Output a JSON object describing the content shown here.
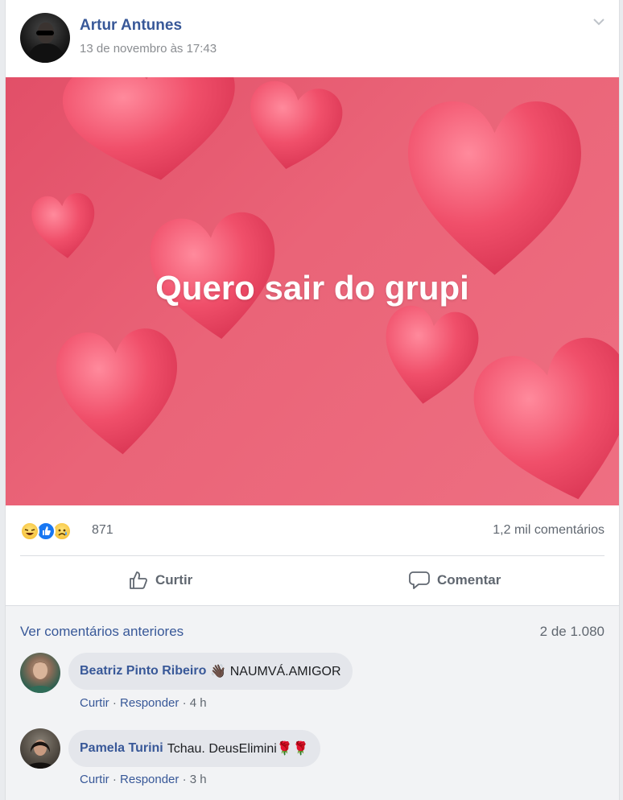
{
  "post": {
    "author": "Artur Antunes",
    "timestamp": "13 de novembro às 17:43",
    "text": "Quero sair do grupi",
    "background_color": "#e85a70",
    "reactions": {
      "icons": [
        "laugh-reaction-icon",
        "like-reaction-icon",
        "sad-reaction-icon"
      ],
      "count": "871"
    },
    "comments_count": "1,2 mil comentários",
    "actions": {
      "like": "Curtir",
      "comment": "Comentar"
    }
  },
  "comments_section": {
    "view_previous": "Ver comentários anteriores",
    "pager": "2 de 1.080",
    "items": [
      {
        "name": "Beatriz Pinto Ribeiro",
        "text": "👋🏿 NAUMVÁ.AMIGOR",
        "like": "Curtir",
        "reply": "Responder",
        "time": "4 h"
      },
      {
        "name": "Pamela Turini",
        "text": "Tchau. DeusElimini🌹🌹",
        "like": "Curtir",
        "reply": "Responder",
        "time": "3 h"
      }
    ]
  },
  "colors": {
    "link_blue": "#385898",
    "muted_gray": "#606770",
    "heart_pink": "#f0546d"
  }
}
